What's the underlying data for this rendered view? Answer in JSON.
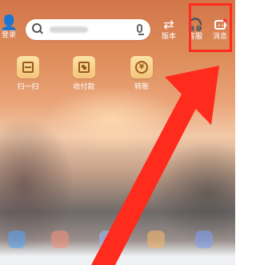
{
  "header": {
    "login_label": "登录",
    "version_label": "版本",
    "service_label": "客服",
    "message_label": "消息",
    "icons": {
      "login": "user-icon",
      "version": "swap-icon",
      "service": "headset-icon",
      "message": "message-icon",
      "search": "search-icon",
      "mic": "mic-icon"
    },
    "search_placeholder": ""
  },
  "quick_actions": [
    {
      "label": "扫一扫",
      "icon": "scan-icon"
    },
    {
      "label": "收付款",
      "icon": "qr-pay-icon"
    },
    {
      "label": "转账",
      "icon": "yen-transfer-icon"
    }
  ],
  "bottom_icons": [
    "blue-app-icon",
    "pink-app-icon",
    "lightblue-app-icon",
    "orange-app-icon",
    "purple-app-icon"
  ],
  "colors": {
    "highlight": "#ff2b1c",
    "arrow": "#ff2b1c"
  }
}
